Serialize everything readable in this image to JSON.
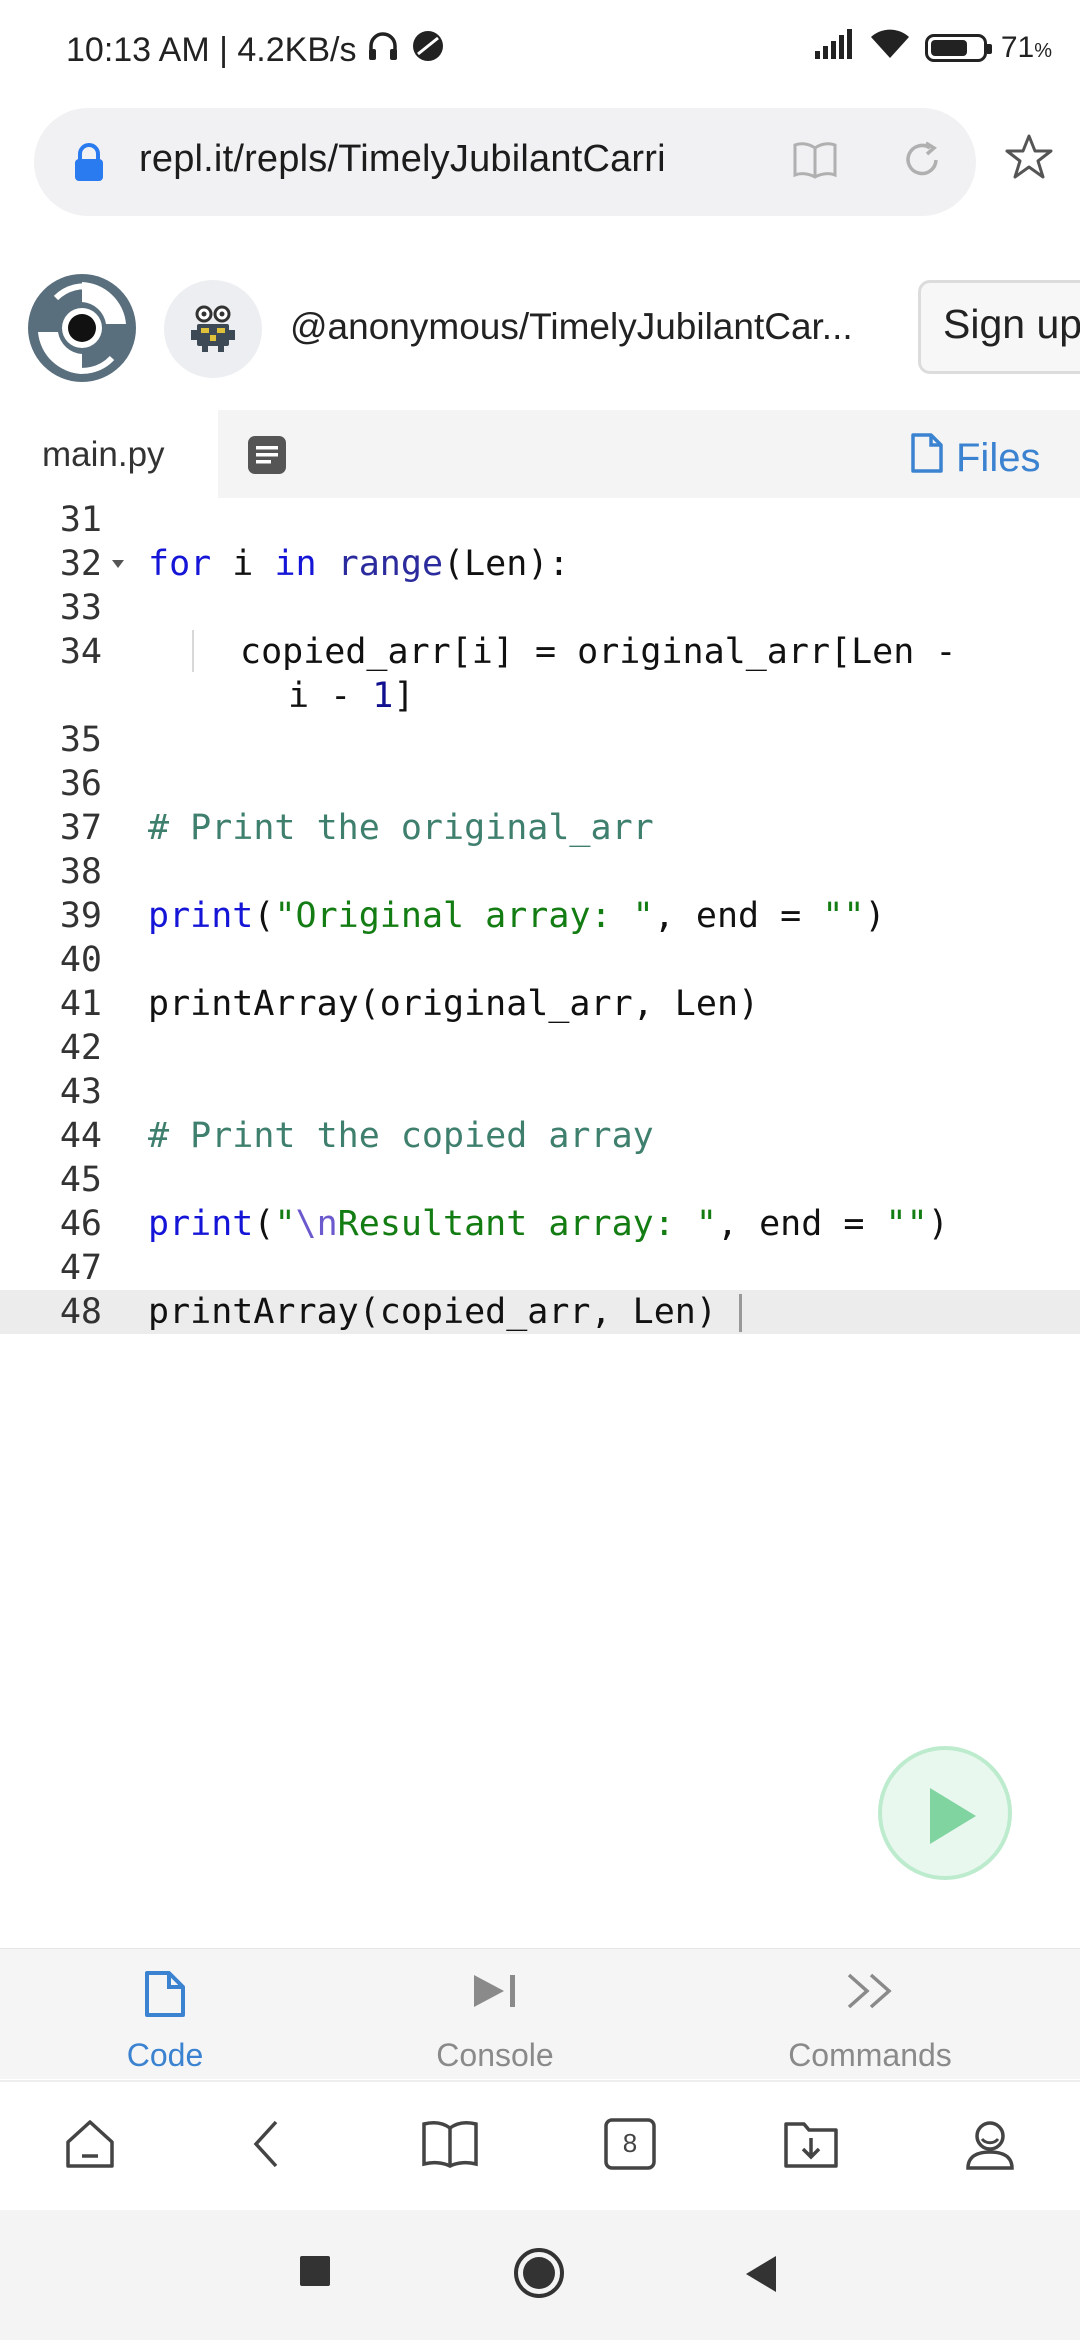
{
  "status": {
    "time_speed": "10:13 AM | 4.2KB/s",
    "battery_level": 0.71,
    "battery_text": "71",
    "battery_unit": "%"
  },
  "browser": {
    "url": "repl.it/repls/TimelyJubilantCarri"
  },
  "repl": {
    "name": "@anonymous/TimelyJubilantCar...",
    "signup_label": "Sign up"
  },
  "tabs": {
    "file_label": "main.py",
    "files_label": "Files"
  },
  "editor": {
    "line_numbers": [
      "31",
      "32",
      "33",
      "34",
      "35",
      "36",
      "37",
      "38",
      "39",
      "40",
      "41",
      "42",
      "43",
      "44",
      "45",
      "46",
      "47",
      "48"
    ]
  },
  "code_text": {
    "l32_for": "for",
    "l32_i": " i ",
    "l32_in": "in",
    "l32_range": " range",
    "l32_rest": "(Len):",
    "l34a": "copied_arr[i] = original_arr[Len -",
    "l34b_pre": "i - ",
    "l34b_num": "1",
    "l34b_post": "]",
    "l37": "# Print the original_arr",
    "l39_fn": "print",
    "l39_open": "(",
    "l39_str": "\"Original array: \"",
    "l39_rest": ", end = ",
    "l39_str2": "\"\"",
    "l39_close": ")",
    "l41": "printArray(original_arr, Len)",
    "l44": "# Print the copied array",
    "l46_fn": "print",
    "l46_open": "(",
    "l46_q": "\"",
    "l46_esc": "\\n",
    "l46_str": "Resultant array: \"",
    "l46_rest": ", end = ",
    "l46_str2": "\"\"",
    "l46_close": ")",
    "l48": "printArray(copied_arr, Len)"
  },
  "repl_nav": {
    "code": "Code",
    "console": "Console",
    "commands": "Commands"
  },
  "browser_toolbar": {
    "tab_count": "8"
  },
  "colors": {
    "accent": "#3b83d1",
    "run_button": "#7fd4a0",
    "nav_inactive": "#8a8a8a"
  },
  "icons": {
    "status": [
      "headphones-icon",
      "vpn-icon",
      "signal-icon",
      "wifi-icon",
      "battery-icon"
    ],
    "address": [
      "lock-icon",
      "reader-mode-icon",
      "reload-icon",
      "star-icon"
    ],
    "tabs": [
      "document-icon",
      "file-icon"
    ],
    "repl_nav": [
      "file-icon",
      "console-icon",
      "chevrons-icon"
    ],
    "browser_toolbar": [
      "home-icon",
      "back-icon",
      "bookmarks-icon",
      "tabs-icon",
      "downloads-icon",
      "profile-icon"
    ],
    "android_nav": [
      "recents-icon",
      "home-circle-icon",
      "back-triangle-icon"
    ]
  }
}
